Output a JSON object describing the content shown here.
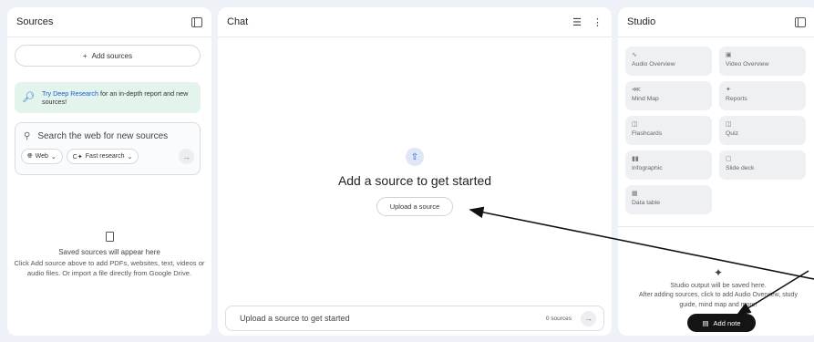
{
  "sources": {
    "title": "Sources",
    "add_sources_label": "Add sources",
    "deep_research_link": "Try Deep Research",
    "deep_research_text": " for an in-depth report and new sources!",
    "search_placeholder": "Search the web for new sources",
    "web_chip": "Web",
    "fast_research_chip": "Fast research",
    "saved_title": "Saved sources will appear here",
    "saved_text": "Click Add source above to add PDFs, websites, text, videos or audio files. Or import a file directly from Google Drive."
  },
  "chat": {
    "title": "Chat",
    "headline": "Add a source to get started",
    "upload_button": "Upload a source",
    "input_placeholder": "Upload a source to get started",
    "source_count": "0 sources"
  },
  "studio": {
    "title": "Studio",
    "tiles": [
      {
        "label": "Audio Overview",
        "icon": "audio-waveform-icon"
      },
      {
        "label": "Video Overview",
        "icon": "video-icon"
      },
      {
        "label": "Mind Map",
        "icon": "mind-map-icon"
      },
      {
        "label": "Reports",
        "icon": "reports-icon"
      },
      {
        "label": "Flashcards",
        "icon": "flashcards-icon"
      },
      {
        "label": "Quiz",
        "icon": "quiz-icon"
      },
      {
        "label": "Infographic",
        "icon": "infographic-icon"
      },
      {
        "label": "Slide deck",
        "icon": "slide-deck-icon"
      },
      {
        "label": "Data table",
        "icon": "data-table-icon"
      }
    ],
    "empty_title": "Studio output will be saved here.",
    "empty_text": "After adding sources, click to add Audio Overview, study guide, mind map and more!",
    "add_note_label": "Add note"
  },
  "colors": {
    "accent": "#1a5dd8",
    "background": "#eef1f8",
    "deep_research_bg": "#e3f4ec",
    "add_note_bg": "#141414"
  }
}
